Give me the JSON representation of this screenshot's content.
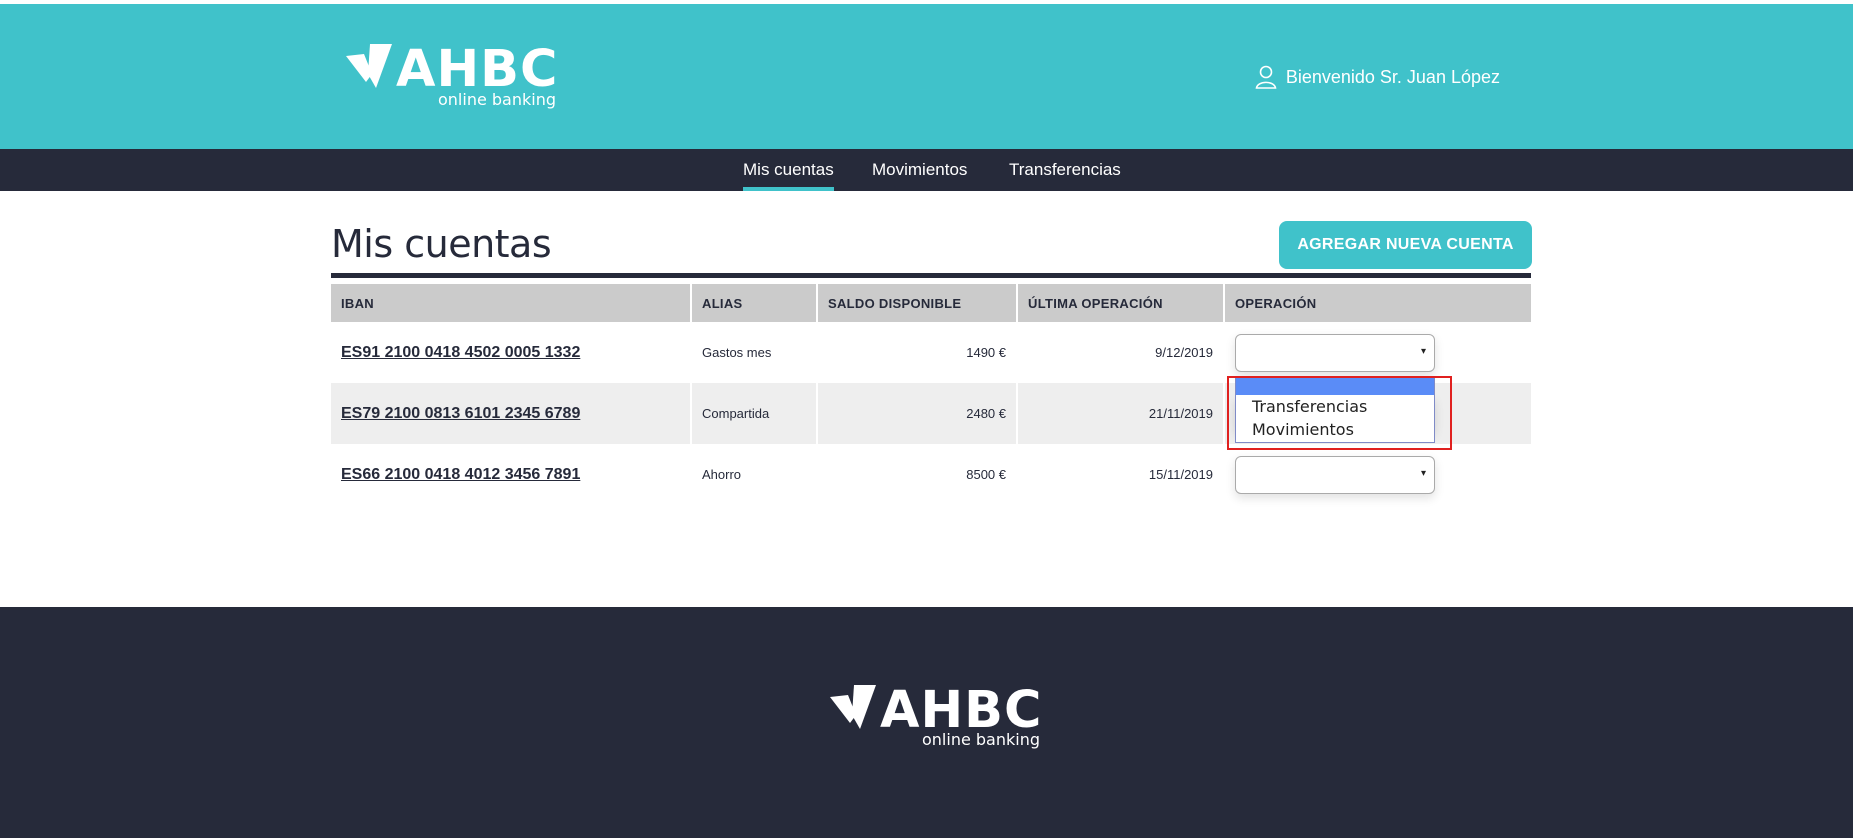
{
  "colors": {
    "accent": "#40c2ca",
    "dark": "#262a3a",
    "table_header": "#cbcbcb",
    "row_alt": "#eeeeee",
    "dropdown_selected": "#5a8cf7",
    "highlight": "#e0201f"
  },
  "header": {
    "logo": {
      "brand": "AHBC",
      "tagline": "online banking"
    },
    "user": {
      "icon": "user-icon",
      "greeting": "Bienvenido Sr. Juan López"
    }
  },
  "nav": {
    "items": [
      {
        "label": "Mis cuentas",
        "active": true
      },
      {
        "label": "Movimientos",
        "active": false
      },
      {
        "label": "Transferencias",
        "active": false
      }
    ]
  },
  "main": {
    "title": "Mis cuentas",
    "add_button": "AGREGAR NUEVA CUENTA",
    "table": {
      "columns": [
        "IBAN",
        "ALIAS",
        "SALDO DISPONIBLE",
        "ÚLTIMA OPERACIÓN",
        "OPERACIÓN"
      ],
      "rows": [
        {
          "iban": "ES91 2100 0418 4502 0005 1332",
          "alias": "Gastos mes",
          "saldo": "1490 €",
          "fecha": "9/12/2019",
          "operacion": ""
        },
        {
          "iban": "ES79 2100 0813 6101 2345 6789",
          "alias": "Compartida",
          "saldo": "2480 €",
          "fecha": "21/11/2019",
          "operacion": ""
        },
        {
          "iban": "ES66 2100 0418 4012 3456 7891",
          "alias": "Ahorro",
          "saldo": "8500 €",
          "fecha": "15/11/2019",
          "operacion": ""
        }
      ]
    },
    "select_arrow": "▾",
    "dropdown": {
      "options": [
        "",
        "Transferencias",
        "Movimientos"
      ]
    }
  },
  "footer": {
    "logo": {
      "brand": "AHBC",
      "tagline": "online banking"
    }
  }
}
